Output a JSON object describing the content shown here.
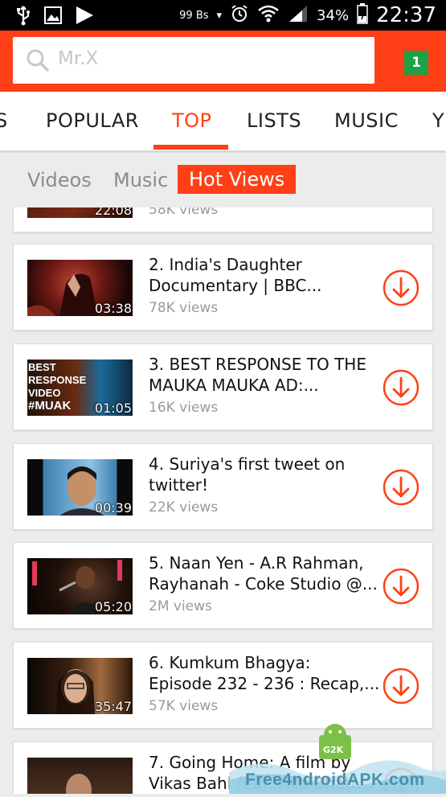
{
  "status_bar": {
    "speed": "99 Bs",
    "battery": "34%",
    "time": "22:37"
  },
  "search": {
    "placeholder": "Mr.X"
  },
  "badge_count": "1",
  "tabs": [
    {
      "label": "S"
    },
    {
      "label": "POPULAR"
    },
    {
      "label": "TOP"
    },
    {
      "label": "LISTS"
    },
    {
      "label": "MUSIC"
    },
    {
      "label": "Y"
    }
  ],
  "subtabs": [
    {
      "label": "Videos"
    },
    {
      "label": "Music"
    },
    {
      "label": "Hot Views"
    }
  ],
  "videos": [
    {
      "duration": "22:08",
      "line1": "",
      "line2": "",
      "views": "58K views"
    },
    {
      "duration": "03:38",
      "line1": "2.  India's Daughter",
      "line2": "Documentary | BBC...",
      "views": "78K views"
    },
    {
      "duration": "01:05",
      "line1": "3.  BEST RESPONSE TO THE",
      "line2": "MAUKA MAUKA AD:...",
      "views": "16K views"
    },
    {
      "duration": "00:39",
      "line1": "4.  Suriya's first tweet on",
      "line2": "twitter!",
      "views": "22K views"
    },
    {
      "duration": "05:20",
      "line1": "5.  Naan Yen - A.R Rahman,",
      "line2": "Rayhanah - Coke Studio @...",
      "views": " 2M views"
    },
    {
      "duration": "35:47",
      "line1": "6.  Kumkum Bhagya:",
      "line2": "Episode 232 - 236 : Recap,...",
      "views": "57K views"
    },
    {
      "duration": "",
      "line1": "7.  Going Home: A film by",
      "line2": "Vikas Bahl feat. Alia Bhatt...",
      "views": ""
    }
  ],
  "thumb_text": {
    "best_response": [
      "BEST",
      "RESPONSE",
      "VIDEO",
      "#MUAK"
    ]
  },
  "watermark": {
    "badge": "G2K",
    "text": "Free4ndroidAPK.com"
  },
  "colors": {
    "accent": "#ff4016",
    "badge": "#1ea046"
  }
}
